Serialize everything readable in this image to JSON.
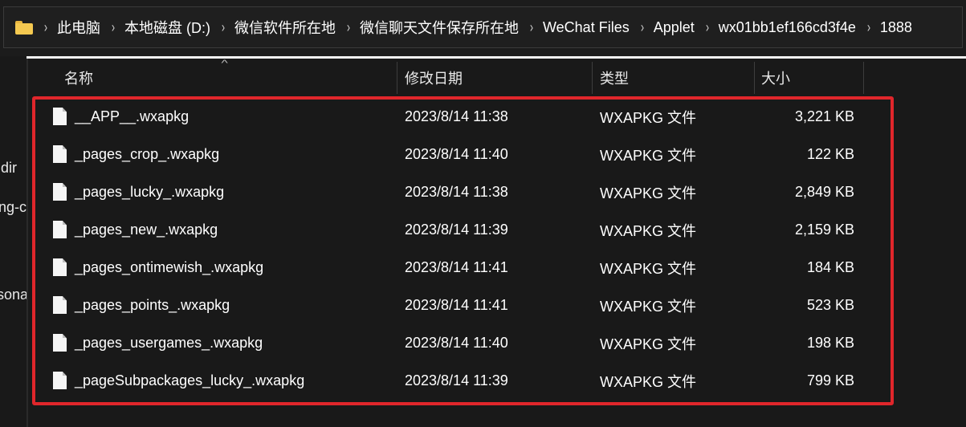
{
  "address": {
    "crumbs": [
      "此电脑",
      "本地磁盘 (D:)",
      "微信软件所在地",
      "微信聊天文件保存所在地",
      "WeChat Files",
      "Applet",
      "wx01bb1ef166cd3f4e",
      "1888"
    ],
    "separator": "›"
  },
  "nav": {
    "items": [
      "dir",
      "ng-c",
      "sona"
    ]
  },
  "columns": {
    "name": "名称",
    "date": "修改日期",
    "type": "类型",
    "size": "大小"
  },
  "files": [
    {
      "name": "__APP__.wxapkg",
      "date": "2023/8/14 11:38",
      "type": "WXAPKG 文件",
      "size": "3,221 KB"
    },
    {
      "name": "_pages_crop_.wxapkg",
      "date": "2023/8/14 11:40",
      "type": "WXAPKG 文件",
      "size": "122 KB"
    },
    {
      "name": "_pages_lucky_.wxapkg",
      "date": "2023/8/14 11:38",
      "type": "WXAPKG 文件",
      "size": "2,849 KB"
    },
    {
      "name": "_pages_new_.wxapkg",
      "date": "2023/8/14 11:39",
      "type": "WXAPKG 文件",
      "size": "2,159 KB"
    },
    {
      "name": "_pages_ontimewish_.wxapkg",
      "date": "2023/8/14 11:41",
      "type": "WXAPKG 文件",
      "size": "184 KB"
    },
    {
      "name": "_pages_points_.wxapkg",
      "date": "2023/8/14 11:41",
      "type": "WXAPKG 文件",
      "size": "523 KB"
    },
    {
      "name": "_pages_usergames_.wxapkg",
      "date": "2023/8/14 11:40",
      "type": "WXAPKG 文件",
      "size": "198 KB"
    },
    {
      "name": "_pageSubpackages_lucky_.wxapkg",
      "date": "2023/8/14 11:39",
      "type": "WXAPKG 文件",
      "size": "799 KB"
    }
  ],
  "colors": {
    "highlight": "#e0262b",
    "folder": "#f5c950",
    "background": "#191919"
  },
  "icons": {
    "address": "folder-icon",
    "file": "file-icon",
    "sort": "sort-ascending-icon"
  }
}
